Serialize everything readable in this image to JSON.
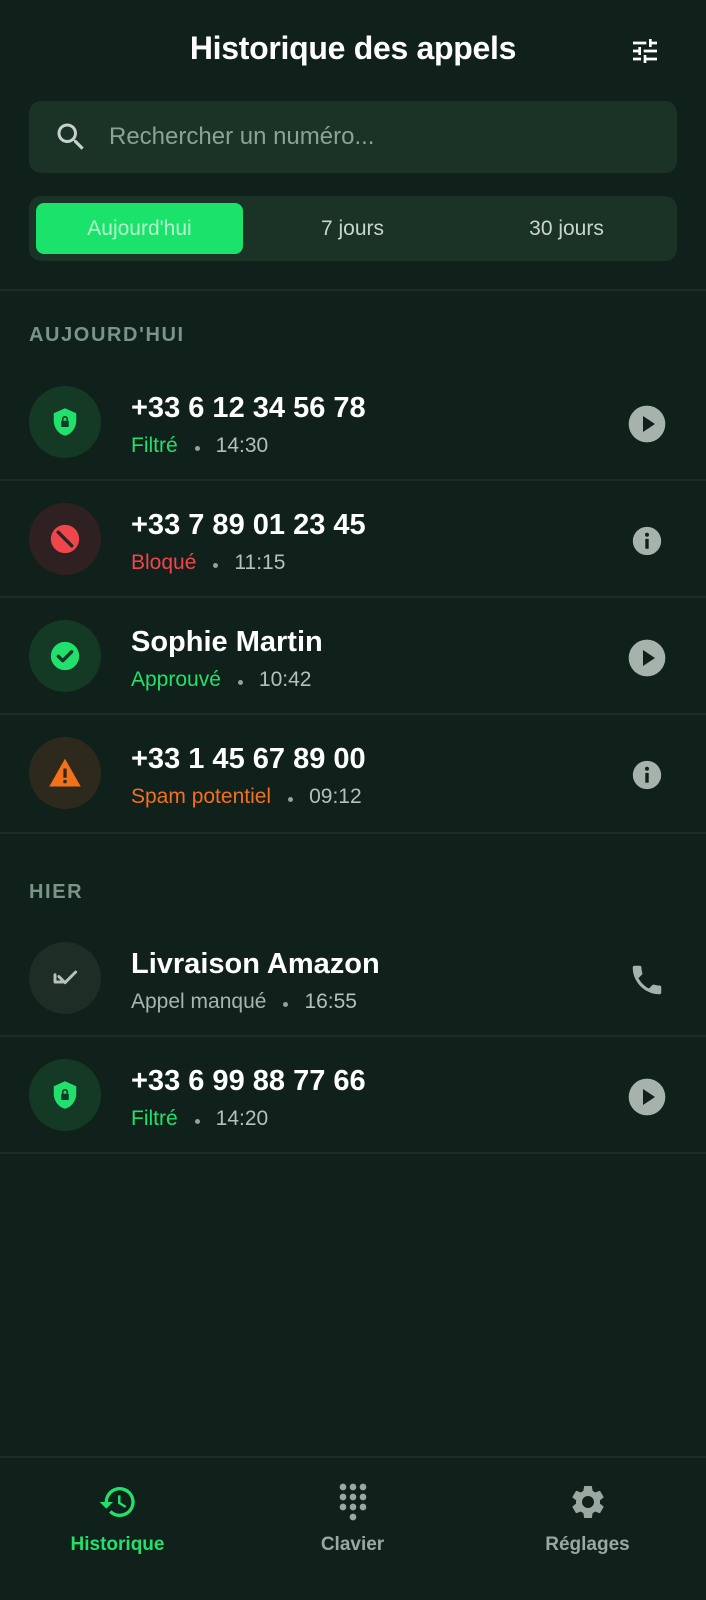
{
  "header": {
    "title": "Historique des appels",
    "filter_icon": "tune-icon"
  },
  "search": {
    "placeholder": "Rechercher un numéro...",
    "value": "",
    "icon": "search-icon"
  },
  "period_tabs": {
    "selected": "Aujourd'hui",
    "items": [
      {
        "label": "Aujourd'hui"
      },
      {
        "label": "7 jours"
      },
      {
        "label": "30 jours"
      }
    ]
  },
  "sections": [
    {
      "label": "AUJOURD'HUI",
      "calls": [
        {
          "title": "+33 6 12 34 56 78",
          "status": "Filtré",
          "time": "14:30",
          "status_color": "#22e06c",
          "avatar_icon": "shield-lock-icon",
          "action_icon": "play-icon"
        },
        {
          "title": "+33 7 89 01 23 45",
          "status": "Bloqué",
          "time": "11:15",
          "status_color": "#f0464b",
          "avatar_icon": "block-icon",
          "action_icon": "info-icon"
        },
        {
          "title": "Sophie Martin",
          "status": "Approuvé",
          "time": "10:42",
          "status_color": "#22e06c",
          "avatar_icon": "check-circle-icon",
          "action_icon": "play-icon"
        },
        {
          "title": "+33 1 45 67 89 00",
          "status": "Spam potentiel",
          "time": "09:12",
          "status_color": "#f3711a",
          "avatar_icon": "warning-icon",
          "action_icon": "info-icon"
        }
      ]
    },
    {
      "label": "HIER",
      "calls": [
        {
          "title": "Livraison Amazon",
          "status": "Appel manqué",
          "time": "16:55",
          "status_color": "#a7b5ae",
          "avatar_icon": "missed-call-icon",
          "action_icon": "phone-icon"
        },
        {
          "title": "+33 6 99 88 77 66",
          "status": "Filtré",
          "time": "14:20",
          "status_color": "#22e06c",
          "avatar_icon": "shield-lock-icon",
          "action_icon": "play-icon"
        }
      ]
    }
  ],
  "bottom_nav": {
    "active": "Historique",
    "items": [
      {
        "label": "Historique",
        "icon": "history-icon"
      },
      {
        "label": "Clavier",
        "icon": "dialpad-icon"
      },
      {
        "label": "Réglages",
        "icon": "settings-icon"
      }
    ]
  },
  "colors": {
    "background": "#10201a",
    "surface": "#1b3226",
    "accent": "#1ae26a",
    "blocked": "#f0464b",
    "spam": "#f3711a",
    "muted": "#a7b5ae"
  }
}
